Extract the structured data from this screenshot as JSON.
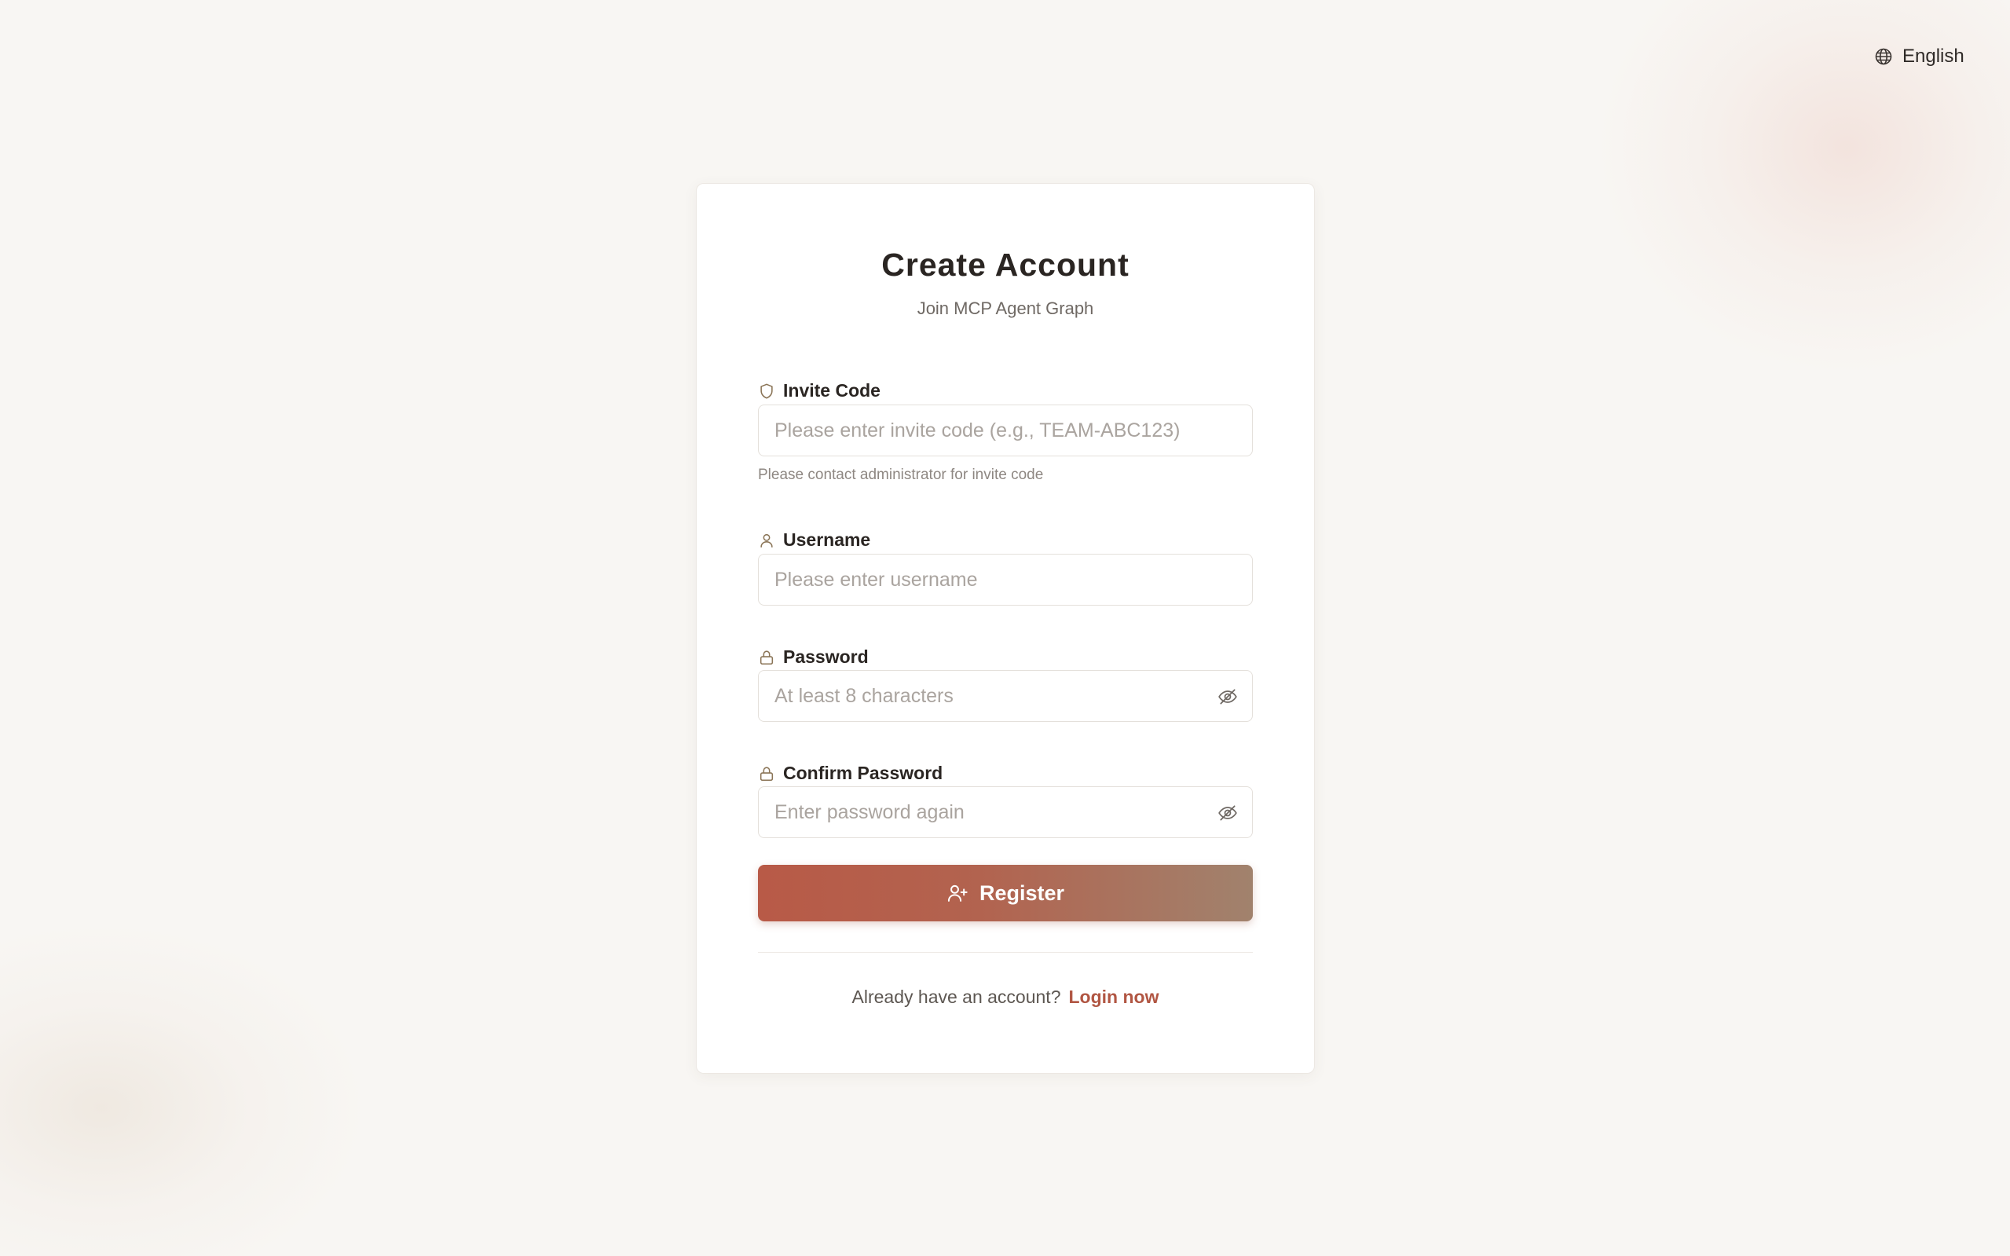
{
  "language": {
    "label": "English",
    "icon": "globe-icon"
  },
  "form": {
    "title": "Create Account",
    "subtitle": "Join MCP Agent Graph",
    "invite_code": {
      "label": "Invite Code",
      "icon": "shield-icon",
      "placeholder": "Please enter invite code (e.g., TEAM-ABC123)",
      "value": "",
      "hint": "Please contact administrator for invite code"
    },
    "username": {
      "label": "Username",
      "icon": "user-icon",
      "placeholder": "Please enter username",
      "value": ""
    },
    "password": {
      "label": "Password",
      "icon": "lock-icon",
      "placeholder": "At least 8 characters",
      "value": ""
    },
    "confirm_password": {
      "label": "Confirm Password",
      "icon": "lock-icon",
      "placeholder": "Enter password again",
      "value": ""
    },
    "register_button": {
      "label": "Register",
      "icon": "user-plus-icon"
    }
  },
  "footer": {
    "prompt": "Already have an account?",
    "link": "Login now"
  },
  "colors": {
    "accent": "#b15643",
    "background": "#f8f6f3",
    "card": "#ffffff",
    "icon_tint": "#8a7456"
  }
}
